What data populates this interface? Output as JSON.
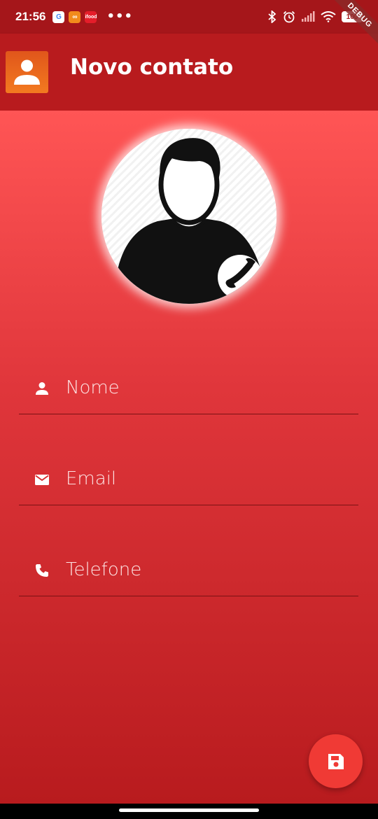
{
  "status_bar": {
    "time": "21:56",
    "notifications": [
      {
        "name": "google-notification-icon",
        "glyph": "G"
      },
      {
        "name": "orange-app-notification-icon",
        "glyph": "∞"
      },
      {
        "name": "ifood-notification-icon",
        "glyph": "ifood"
      }
    ],
    "more_glyph": "•••",
    "battery": "100",
    "debug_banner": "DEBUG"
  },
  "app_bar": {
    "title": "Novo contato",
    "logo_icon": "contact-person-icon"
  },
  "form": {
    "name": {
      "placeholder": "Nome",
      "value": "",
      "icon": "person-icon"
    },
    "email": {
      "placeholder": "Email",
      "value": "",
      "icon": "email-icon"
    },
    "phone": {
      "placeholder": "Telefone",
      "value": "",
      "icon": "phone-icon"
    }
  },
  "fab": {
    "icon": "save-icon"
  },
  "colors": {
    "primary_dark": "#a5161a",
    "primary": "#b81b1e",
    "gradient_top": "#ff5555",
    "gradient_bottom": "#b81b1e",
    "fab": "#f03a35"
  }
}
